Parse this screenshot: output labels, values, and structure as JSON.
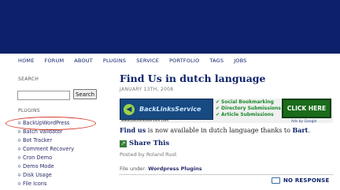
{
  "nav": [
    "HOME",
    "FORUM",
    "ABOUT",
    "PLUGINS",
    "SERVICE",
    "PORTFOLIO",
    "TAGS",
    "JOBS"
  ],
  "sidebar": {
    "search_heading": "SEARCH",
    "search_button": "Search",
    "plugins_heading": "PLUGINS",
    "plugins": [
      "BackUpWordPress",
      "Batch Validator",
      "Bot Tracker",
      "Comment Recovery",
      "Cron Demo",
      "Demo Mode",
      "Disk Usage",
      "File Icons"
    ]
  },
  "post": {
    "title": "Find Us in dutch language",
    "date": "JANUARY 13TH, 2008",
    "banner": {
      "logo_text": "BackLinksService",
      "url": "www.backlinksservice.com",
      "bullets": [
        "Social Bookmarking",
        "Directory Submissions",
        "Article Submissions"
      ],
      "cta": "CLICK HERE",
      "ads": "Ads by Google"
    },
    "body_prefix": "Find us",
    "body_middle": " is now available in dutch  language thanks to ",
    "body_link": "Bart",
    "body_suffix": ".",
    "share": "Share This",
    "posted_by": "Posted by Roland Rust",
    "filed_label": "File under: ",
    "filed_category": "Wordpress Plugins",
    "responses": "NO RESPONSE"
  },
  "colors": {
    "header": "#0c2169",
    "highlight": "#d63b2a"
  }
}
